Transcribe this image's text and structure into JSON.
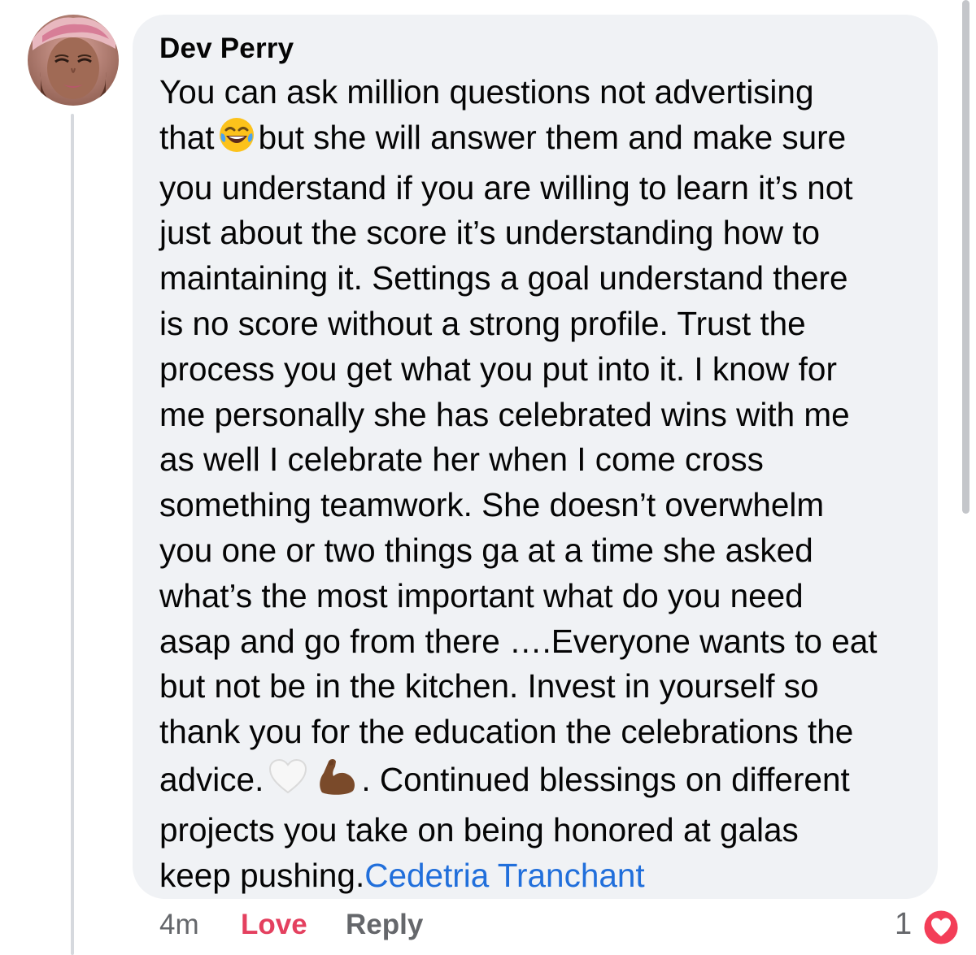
{
  "comment": {
    "author": "Dev Perry",
    "body_lines": [
      [
        "You can ask million questions not advertising"
      ],
      [
        "that",
        "laughing-face-emoji",
        "but she will answer them and make sure"
      ],
      [
        "you understand if you are willing to learn it’s not"
      ],
      [
        "just about the score it’s understanding how to"
      ],
      [
        "maintaining it. Settings a goal understand there"
      ],
      [
        "is no score without a strong profile. Trust the"
      ],
      [
        "process you get what you put into it. I know for"
      ],
      [
        "me personally she has celebrated wins with me"
      ],
      [
        "as well I celebrate her when I come cross"
      ],
      [
        "something teamwork. She doesn’t overwhelm"
      ],
      [
        "you one or two things ga at a time she asked"
      ],
      [
        "what’s the most important what do you need"
      ],
      [
        "asap and go from there ….Everyone wants to eat"
      ],
      [
        "but not be in the kitchen. Invest in yourself so"
      ],
      [
        "thank you for the education the celebrations the"
      ],
      [
        "advice.",
        "white-heart-emoji",
        "flexed-biceps-emoji",
        ". Continued blessings on different"
      ],
      [
        "projects you take on being honored at galas"
      ],
      [
        "keep pushing."
      ]
    ],
    "mention": "Cedetria Tranchant",
    "mention_color": "#216fdb"
  },
  "actions": {
    "timestamp": "4m",
    "love_label": "Love",
    "love_color": "#e4405f",
    "reply_label": "Reply",
    "reaction_count": "1",
    "reaction_icon": "love-reaction-icon"
  },
  "colors": {
    "bubble": "#f0f2f5",
    "text": "#050505",
    "secondary": "#65676b"
  }
}
